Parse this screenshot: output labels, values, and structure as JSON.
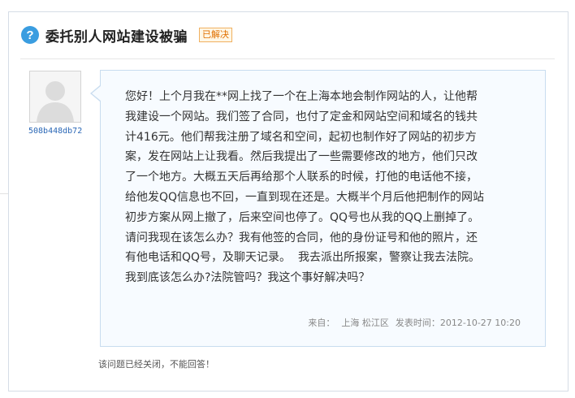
{
  "question": {
    "title": "委托别人网站建设被骗",
    "status_badge": "已解决",
    "icon": "question-icon"
  },
  "asker": {
    "username": "508b448db72",
    "avatar_icon": "default-avatar-icon"
  },
  "body_lines": [
    "您好！上个月我在**网上找了一个在上海本地会制作网站的人，让他帮",
    "我建设一个网站。我们签了合同，也付了定金和网站空间和域名的钱共",
    "计416元。他们帮我注册了域名和空间，起初也制作好了网站的初步方",
    "案，发在网站上让我看。然后我提出了一些需要修改的地方，他们只改",
    "了一个地方。大概五天后再给那个人联系的时候，打他的电话他不接，",
    "给他发QQ信息也不回，一直到现在还是。大概半个月后他把制作的网站",
    "初步方案从网上撤了，后来空间也停了。QQ号也从我的QQ上删掉了。",
    "请问我现在该怎么办？我有他签的合同，他的身份证号和他的照片，还",
    "有他电话和QQ号，及聊天记录。  我去派出所报案，警察让我去法院。",
    "我到底该怎么办?法院管吗？我这个事好解决吗？"
  ],
  "meta": {
    "from_label": "来自：",
    "location": "上海 松江区",
    "time_label": "发表时间：",
    "time": "2012-10-27 10:20"
  },
  "closed_notice": "该问题已经关闭，不能回答！",
  "colors": {
    "accent_blue": "#3a9de0",
    "badge_orange": "#e07000",
    "link_blue": "#2a67b6",
    "bubble_border": "#c8dcef"
  }
}
